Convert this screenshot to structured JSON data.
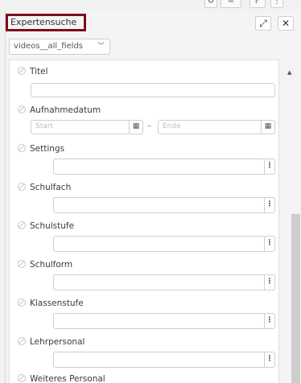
{
  "topbar": {
    "icons": [
      "refresh-icon",
      "sort-icon",
      "share-icon",
      "more-icon"
    ]
  },
  "panel": {
    "title": "Expertensuche",
    "expand_icon": "expand-icon",
    "close_icon": "close-icon"
  },
  "selector": {
    "value": "videos__all_fields",
    "chevron": "chevron-down-icon"
  },
  "fields": [
    {
      "label": "Titel",
      "type": "text"
    },
    {
      "label": "Aufnahmedatum",
      "type": "daterange",
      "start_placeholder": "Start",
      "end_placeholder": "Ende",
      "separator": "–"
    },
    {
      "label": "Settings",
      "type": "lookup"
    },
    {
      "label": "Schulfach",
      "type": "lookup"
    },
    {
      "label": "Schulstufe",
      "type": "lookup"
    },
    {
      "label": "Schulform",
      "type": "lookup"
    },
    {
      "label": "Klassenstufe",
      "type": "lookup"
    },
    {
      "label": "Lehrpersonal",
      "type": "lookup"
    },
    {
      "label": "Weiteres Personal",
      "type": "lookup"
    }
  ],
  "colors": {
    "title_highlight": "#7a0f1a",
    "scroll_thumb": "#cdcdcd"
  }
}
